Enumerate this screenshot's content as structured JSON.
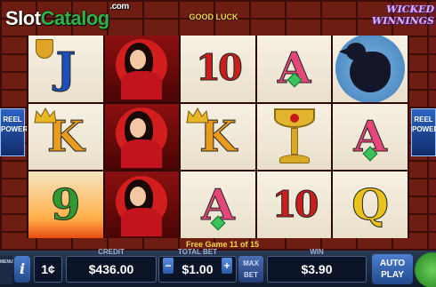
{
  "header": {
    "logo_main": "Slot",
    "logo_accent": "Catalog",
    "logo_suffix": ".com",
    "good_luck": "GOOD LUCK",
    "game_title": "WICKED WINNINGS"
  },
  "side_power": {
    "left_text": "REEL POWER",
    "right_text": "REEL POWER"
  },
  "reels": [
    [
      {
        "symbol": "J",
        "kind": "letter",
        "style": "j"
      },
      {
        "symbol": "K",
        "kind": "letter",
        "style": "k"
      },
      {
        "symbol": "9",
        "kind": "letter",
        "style": "nine"
      }
    ],
    [
      {
        "symbol": "devil-lady",
        "kind": "picture"
      },
      {
        "symbol": "devil-lady",
        "kind": "picture"
      },
      {
        "symbol": "devil-lady",
        "kind": "picture"
      }
    ],
    [
      {
        "symbol": "10",
        "kind": "letter",
        "style": "ten"
      },
      {
        "symbol": "K",
        "kind": "letter",
        "style": "k"
      },
      {
        "symbol": "A",
        "kind": "letter",
        "style": "a"
      }
    ],
    [
      {
        "symbol": "A",
        "kind": "letter",
        "style": "a"
      },
      {
        "symbol": "chalice",
        "kind": "picture"
      },
      {
        "symbol": "10",
        "kind": "letter",
        "style": "ten"
      }
    ],
    [
      {
        "symbol": "raven",
        "kind": "picture"
      },
      {
        "symbol": "A",
        "kind": "letter",
        "style": "a"
      },
      {
        "symbol": "Q",
        "kind": "letter",
        "style": "q"
      }
    ]
  ],
  "free_game_text": "Free Game 11 of 15",
  "controls": {
    "menu_label": "MENU",
    "info_label": "i",
    "denomination": "1¢",
    "credit_label": "CREDIT",
    "credit_value": "$436.00",
    "total_bet_label": "TOTAL BET",
    "total_bet_value": "$1.00",
    "minus_label": "−",
    "plus_label": "+",
    "max_bet_label": "MAX BET",
    "win_label": "WIN",
    "win_value": "$3.90",
    "autoplay_label": "AUTO PLAY"
  }
}
